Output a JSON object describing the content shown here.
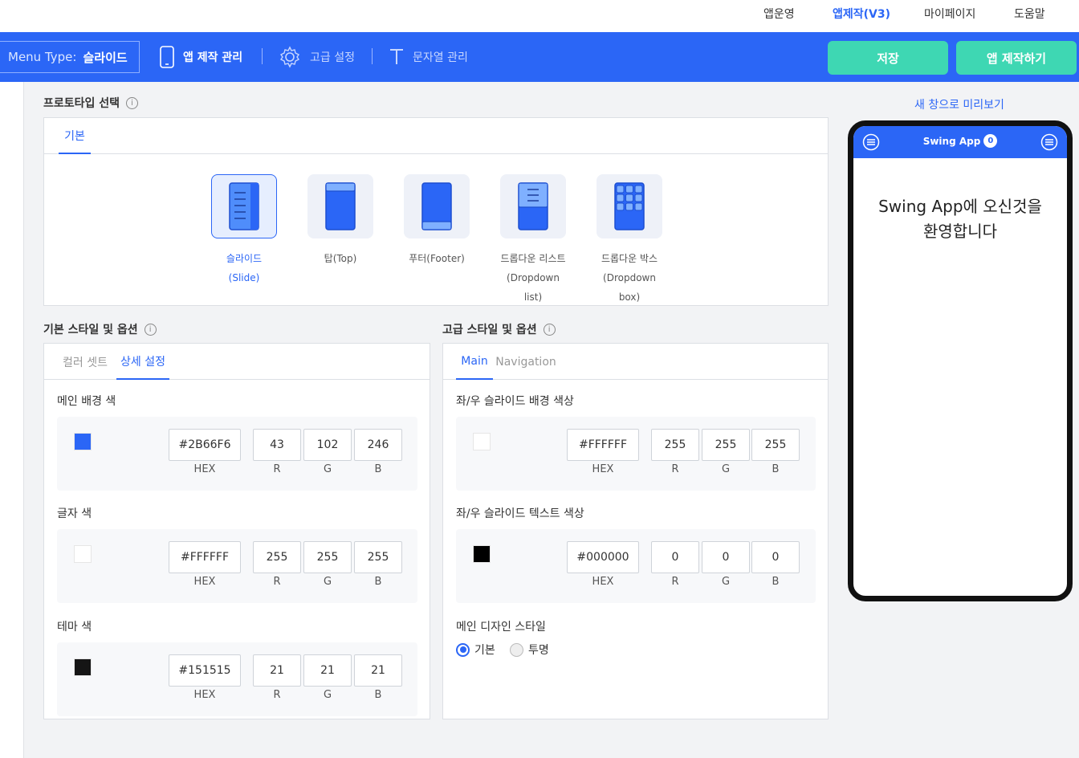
{
  "top_nav": [
    "앱운영",
    "앱제작(V3)",
    "마이페이지",
    "도움말"
  ],
  "toolbar": {
    "menu_type_label": "Menu Type:",
    "menu_type_value": "슬라이드",
    "items": [
      "앱 제작 관리",
      "고급 설정",
      "문자열 관리"
    ],
    "save": "저장",
    "build": "앱 제작하기"
  },
  "prototype": {
    "title": "프로토타입 선택",
    "tab": "기본",
    "options": [
      {
        "line1": "슬라이드(Slide)",
        "line2": ""
      },
      {
        "line1": "탑(Top)",
        "line2": ""
      },
      {
        "line1": "푸터(Footer)",
        "line2": ""
      },
      {
        "line1": "드롭다운 리스트",
        "line2": "(Dropdown list)"
      },
      {
        "line1": "드롭다운 박스",
        "line2": "(Dropdown box)"
      }
    ]
  },
  "basic_style": {
    "title": "기본 스타일 및 옵션",
    "tabs": [
      "컬러 셋트",
      "상세 설정"
    ],
    "rows": [
      {
        "label": "메인 배경 색",
        "hex": "#2B66F6",
        "r": "43",
        "g": "102",
        "b": "246",
        "color": "#2b66f6"
      },
      {
        "label": "글자 색",
        "hex": "#FFFFFF",
        "r": "255",
        "g": "255",
        "b": "255",
        "color": "#ffffff"
      },
      {
        "label": "테마 색",
        "hex": "#151515",
        "r": "21",
        "g": "21",
        "b": "21",
        "color": "#151515"
      }
    ]
  },
  "advanced_style": {
    "title": "고급 스타일 및 옵션",
    "tabs": [
      "Main",
      "Navigation"
    ],
    "rows": [
      {
        "label": "좌/우 슬라이드 배경 색상",
        "hex": "#FFFFFF",
        "r": "255",
        "g": "255",
        "b": "255",
        "color": "#ffffff"
      },
      {
        "label": "좌/우 슬라이드 텍스트 색상",
        "hex": "#000000",
        "r": "0",
        "g": "0",
        "b": "0",
        "color": "#000000"
      }
    ],
    "design_style_label": "메인 디자인 스타일",
    "design_options": [
      "기본",
      "투명"
    ]
  },
  "channel_labels": {
    "hex": "HEX",
    "r": "R",
    "g": "G",
    "b": "B"
  },
  "preview": {
    "link": "새 창으로 미리보기",
    "app_name": "Swing App",
    "badge": "0",
    "welcome_line1": "Swing App에 오신것을",
    "welcome_line2": "환영합니다"
  },
  "colors": {
    "primary": "#2b66f6",
    "accent_green": "#3ed7b3"
  }
}
